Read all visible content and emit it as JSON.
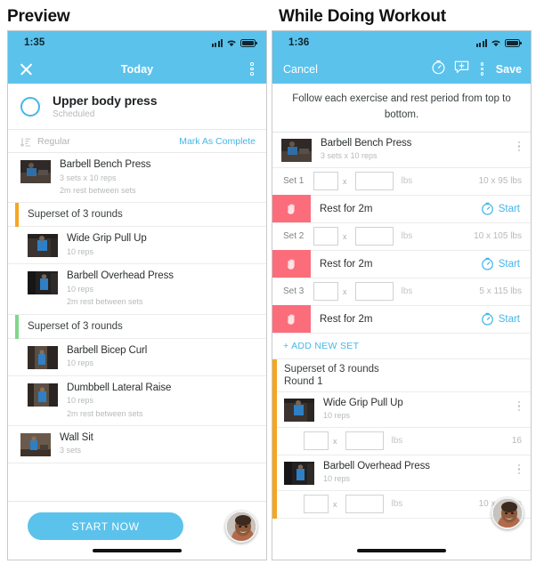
{
  "panels": {
    "left_title": "Preview",
    "right_title": "While Doing Workout"
  },
  "left": {
    "status": {
      "time": "1:35",
      "signal_icon": "cellular-signal-icon",
      "wifi_icon": "wifi-icon",
      "battery_icon": "battery-icon"
    },
    "nav": {
      "close_icon": "close-icon",
      "title": "Today",
      "menu_icon": "kebab-menu-icon"
    },
    "workout": {
      "title": "Upper body press",
      "status": "Scheduled",
      "checkbox_icon": "circle-checkbox-icon"
    },
    "sortbar": {
      "sort_icon": "sort-descending-icon",
      "label": "Regular",
      "action": "Mark As Complete"
    },
    "items": [
      {
        "type": "exercise",
        "name": "Barbell Bench Press",
        "meta1": "3 sets x 10 reps",
        "meta2": "2m rest between sets",
        "thumb": "bench-press-thumbnail"
      },
      {
        "type": "superset",
        "heading": "Superset of 3 rounds",
        "color": "#F5A623",
        "exercises": [
          {
            "name": "Wide Grip Pull Up",
            "meta1": "10 reps",
            "meta2": "",
            "thumb": "pull-up-thumbnail"
          },
          {
            "name": "Barbell Overhead Press",
            "meta1": "10 reps",
            "meta2": "2m rest between sets",
            "thumb": "overhead-press-thumbnail"
          }
        ]
      },
      {
        "type": "superset",
        "heading": "Superset of 3 rounds",
        "color": "#7ED98A",
        "exercises": [
          {
            "name": "Barbell Bicep Curl",
            "meta1": "10 reps",
            "meta2": "",
            "thumb": "bicep-curl-thumbnail"
          },
          {
            "name": "Dumbbell Lateral Raise",
            "meta1": "10 reps",
            "meta2": "2m rest between sets",
            "thumb": "lateral-raise-thumbnail"
          }
        ]
      },
      {
        "type": "exercise",
        "name": "Wall Sit",
        "meta1": "3 sets",
        "meta2": "",
        "thumb": "wall-sit-thumbnail"
      }
    ],
    "footer": {
      "start_label": "START NOW",
      "avatar": "user-avatar"
    }
  },
  "right": {
    "status": {
      "time": "1:36",
      "signal_icon": "cellular-signal-icon",
      "wifi_icon": "wifi-icon",
      "battery_icon": "battery-icon"
    },
    "nav": {
      "cancel_label": "Cancel",
      "timer_icon": "stopwatch-icon",
      "note_icon": "add-note-icon",
      "menu_icon": "kebab-menu-icon",
      "save_label": "Save"
    },
    "instructions": "Follow each exercise and rest period from top to bottom.",
    "exercise": {
      "name": "Barbell Bench Press",
      "meta": "3 sets x 10 reps",
      "thumb": "bench-press-thumbnail"
    },
    "units_label": "lbs",
    "multiply_symbol": "x",
    "rows": [
      {
        "type": "set",
        "label": "Set 1",
        "reps": "",
        "weight": "",
        "previous": "10 x 95 lbs"
      },
      {
        "type": "rest",
        "label": "Rest for 2m",
        "action": "Start",
        "icon": "stop-hand-icon",
        "timer_icon": "timer-icon"
      },
      {
        "type": "set",
        "label": "Set 2",
        "reps": "",
        "weight": "",
        "previous": "10 x 105 lbs"
      },
      {
        "type": "rest",
        "label": "Rest for 2m",
        "action": "Start",
        "icon": "stop-hand-icon",
        "timer_icon": "timer-icon"
      },
      {
        "type": "set",
        "label": "Set 3",
        "reps": "",
        "weight": "",
        "previous": "5 x 115 lbs"
      },
      {
        "type": "rest",
        "label": "Rest for 2m",
        "action": "Start",
        "icon": "stop-hand-icon",
        "timer_icon": "timer-icon"
      }
    ],
    "add_new_set": "+ ADD NEW SET",
    "superset": {
      "heading": "Superset of 3 rounds",
      "round": "Round 1",
      "color": "#F5A623",
      "exercises": [
        {
          "name": "Wide Grip Pull Up",
          "meta": "10 reps",
          "thumb": "pull-up-thumbnail",
          "previous": "16"
        },
        {
          "name": "Barbell Overhead Press",
          "meta": "10 reps",
          "thumb": "overhead-press-thumbnail",
          "previous": "10 x 75 lbs"
        }
      ]
    },
    "avatar": "user-avatar"
  },
  "colors": {
    "accent_blue": "#5BC2EC",
    "link_blue": "#45B7E8",
    "rest_pink": "#FB6D7B",
    "superset_orange": "#F5A623",
    "superset_green": "#7ED98A"
  }
}
